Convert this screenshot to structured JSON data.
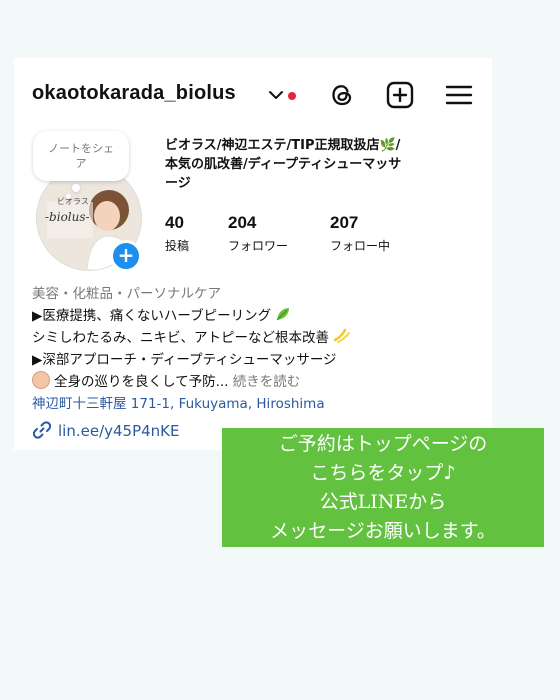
{
  "profile": {
    "username": "okaotokarada_biolus",
    "note_prompt": "ノートをシェア",
    "avatar_text_top": "ビオラス",
    "avatar_text_main": "-biolus-",
    "title_lines": [
      "ビオラス/神辺エステ/TIP正規取扱店🌿/",
      "本気の肌改善/ディープティシューマッサ",
      "ージ"
    ],
    "stats": [
      {
        "value": "40",
        "label": "投稿"
      },
      {
        "value": "204",
        "label": "フォロワー"
      },
      {
        "value": "207",
        "label": "フォロー中"
      }
    ],
    "category": "美容・化粧品・パーソナルケア",
    "bio_lines": [
      "▶医療提携、痛くないハーブピーリング",
      "シミしわたるみ、ニキビ、アトピーなど根本改善",
      "▶深部アプローチ・ディープティシューマッサージ",
      "全身の巡りを良くして予防..."
    ],
    "more_label": "続きを読む",
    "address": "神辺町十三軒屋 171-1, Fukuyama, Hiroshima",
    "link": "lin.ee/y45P4nKE"
  },
  "icons": [
    "chevron-down-icon",
    "threads-icon",
    "new-post-icon",
    "menu-icon",
    "leaf-emoji-icon",
    "sparkle-emoji-icon",
    "link-icon"
  ],
  "promo": {
    "lines": [
      "ご予約はトップページの",
      "こちらをタップ♪",
      "公式LINEから",
      "メッセージお願いします。"
    ]
  },
  "colors": {
    "accent_blue": "#1f8fef",
    "link_blue": "#2a5aa0",
    "promo_green": "#62c13f",
    "notification_red": "#e5243b"
  }
}
